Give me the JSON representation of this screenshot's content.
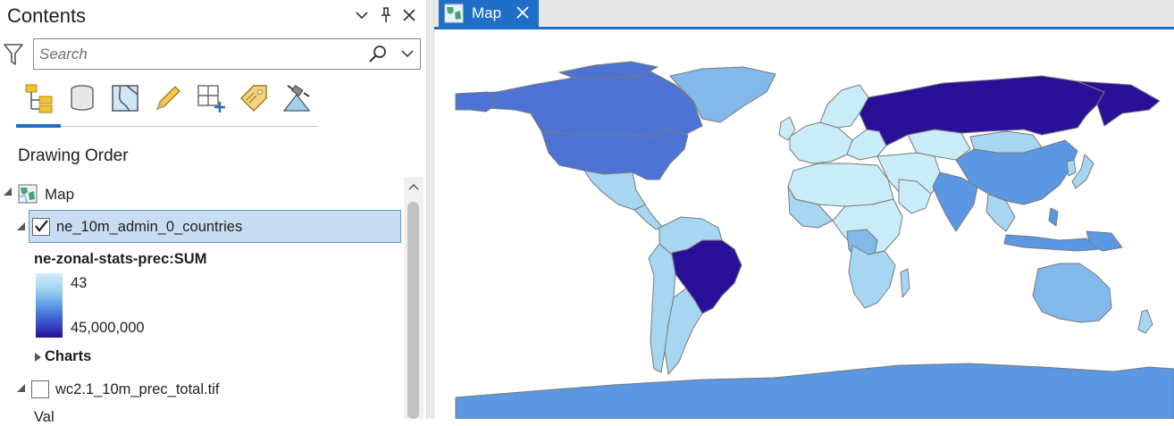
{
  "contents_pane": {
    "title": "Contents",
    "search": {
      "placeholder": "Search",
      "value": ""
    },
    "section_heading": "Drawing Order",
    "map_node": {
      "label": "Map"
    },
    "layers": [
      {
        "name": "ne_10m_admin_0_countries",
        "checked": true,
        "selected": true,
        "symbology": {
          "field": "ne-zonal-stats-prec:SUM",
          "high_label": "43",
          "low_label": "45,000,000",
          "ramp_colors": [
            "#cfeefb",
            "#9fd4f2",
            "#5f9ae6",
            "#3c55cd",
            "#2a0f98"
          ]
        },
        "sublist": "Charts"
      },
      {
        "name": "wc2.1_10m_prec_total.tif",
        "checked": false
      }
    ],
    "cut_off_text": "Val"
  },
  "map_view": {
    "tab_label": "Map",
    "ocean_color": "#ffffff",
    "country_border_color": "#7a7a7a",
    "fill_classes": {
      "very_low": "#c8ecf8",
      "low": "#a6d6f1",
      "medium": "#82b8ea",
      "medium_high": "#5b97e2",
      "high": "#4d74d4",
      "highest": "#2a0f98"
    },
    "colors": {
      "accent": "#1f6ec8",
      "selection_fill": "#c9ddf2",
      "selection_border": "#5f9ad6"
    }
  }
}
